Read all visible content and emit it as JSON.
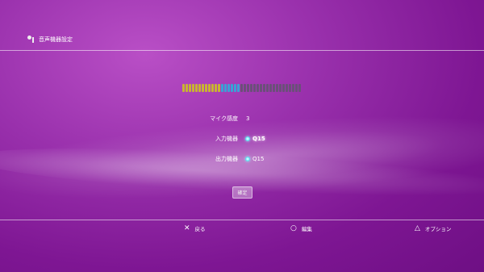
{
  "header": {
    "title": "音声機器設定",
    "icon": "mic-settings-icon"
  },
  "meter": {
    "active_yellow": 12,
    "active_blue": 6,
    "inactive": 19,
    "colors": {
      "yellow": "#c9b431",
      "blue": "#3aa2d6",
      "inactive": "#6b4f79"
    }
  },
  "settings": [
    {
      "label": "マイク感度",
      "value": "3"
    },
    {
      "label": "入力機器",
      "value": "Q15",
      "icon": "selector-dot-icon"
    },
    {
      "label": "出力機器",
      "value": "Q15",
      "icon": "selector-dot-icon"
    }
  ],
  "confirm_label": "確定",
  "footer": {
    "back": {
      "icon": "✕",
      "label": "戻る"
    },
    "edit": {
      "icon": "○",
      "label": "編集"
    },
    "options": {
      "icon": "△",
      "label": "オプション"
    }
  }
}
